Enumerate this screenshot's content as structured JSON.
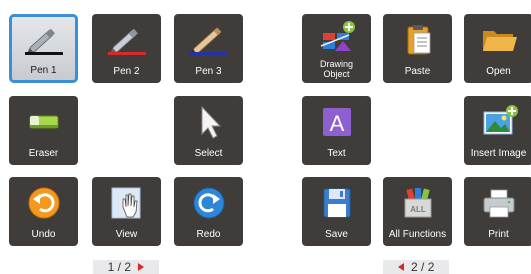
{
  "page1": {
    "pen1": {
      "label": "Pen 1",
      "stroke_color": "#111111"
    },
    "pen2": {
      "label": "Pen 2",
      "stroke_color": "#d42a2a"
    },
    "pen3": {
      "label": "Pen 3",
      "stroke_color": "#2432a8"
    },
    "eraser": {
      "label": "Eraser"
    },
    "select": {
      "label": "Select"
    },
    "undo": {
      "label": "Undo"
    },
    "view": {
      "label": "View"
    },
    "redo": {
      "label": "Redo"
    },
    "pager": {
      "current": "1",
      "separator": "/",
      "total": "2"
    }
  },
  "page2": {
    "drawing_object": {
      "label_line1": "Drawing",
      "label_line2": "Object"
    },
    "paste": {
      "label": "Paste"
    },
    "open": {
      "label": "Open"
    },
    "text": {
      "label": "Text",
      "glyph": "A"
    },
    "insert_image": {
      "label": "Insert Image"
    },
    "save": {
      "label": "Save"
    },
    "all_functions": {
      "label": "All Functions",
      "badge_text": "ALL"
    },
    "print": {
      "label": "Print"
    },
    "pager": {
      "current": "2",
      "separator": "/",
      "total": "2"
    }
  },
  "colors": {
    "tile_bg": "#3f3c3a",
    "selected_border": "#3a90d6",
    "pager_arrow": "#d42a2a",
    "pager_bg": "#e9e9ec"
  }
}
